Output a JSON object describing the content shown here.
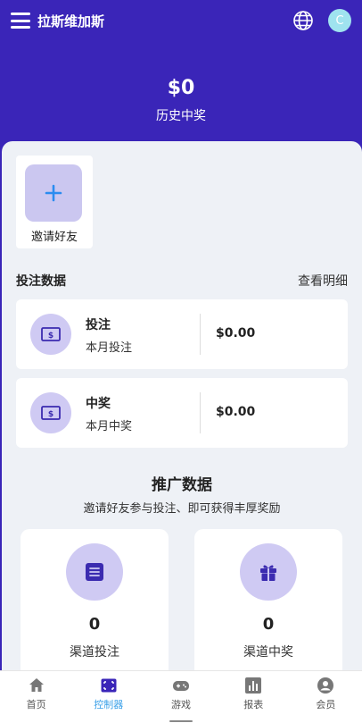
{
  "header": {
    "title": "拉斯维加斯",
    "avatar_letter": "C",
    "icons": {
      "menu": "menu-icon",
      "language": "globe-icon"
    }
  },
  "hero": {
    "amount": "$0",
    "label": "历史中奖"
  },
  "invite": {
    "label": "邀请好友",
    "icon": "plus-icon"
  },
  "bet_data": {
    "title": "投注数据",
    "link": "查看明细",
    "cards": [
      {
        "title": "投注",
        "subtitle": "本月投注",
        "value": "$0.00",
        "icon": "cash-icon"
      },
      {
        "title": "中奖",
        "subtitle": "本月中奖",
        "value": "$0.00",
        "icon": "cash-icon"
      }
    ]
  },
  "promo": {
    "title": "推广数据",
    "subtitle": "邀请好友参与投注、即可获得丰厚奖励",
    "cards": [
      {
        "value": "0",
        "label": "渠道投注",
        "icon": "list-icon"
      },
      {
        "value": "0",
        "label": "渠道中奖",
        "icon": "gift-icon"
      }
    ]
  },
  "nav": {
    "items": [
      {
        "label": "首页",
        "icon": "home-icon",
        "active": false
      },
      {
        "label": "控制器",
        "icon": "controller-icon",
        "active": true
      },
      {
        "label": "游戏",
        "icon": "gamepad-icon",
        "active": false
      },
      {
        "label": "报表",
        "icon": "chart-icon",
        "active": false
      },
      {
        "label": "会员",
        "icon": "user-icon",
        "active": false
      }
    ]
  },
  "colors": {
    "header_bg": "#3a25b8",
    "content_bg": "#eef1f6",
    "icon_circle": "#cfcaf3",
    "icon_fill": "#3b2bb0",
    "plus_blue": "#2b8cf0",
    "nav_active": "#3aa0e8",
    "avatar_bg": "#9fe3ef"
  }
}
